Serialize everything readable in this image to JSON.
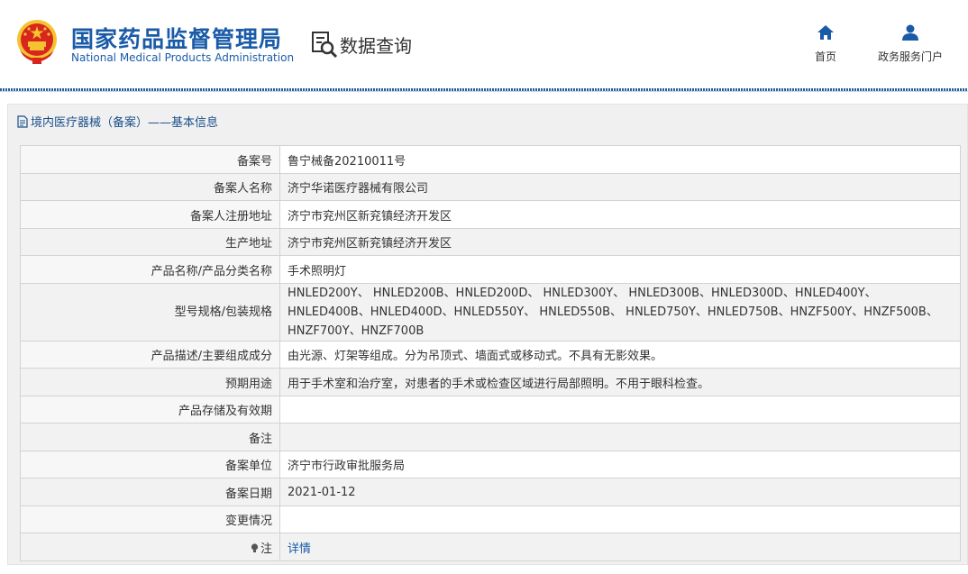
{
  "header": {
    "org_name_cn": "国家药品监督管理局",
    "org_name_en": "National Medical Products Administration",
    "query_label": "数据查询",
    "nav": [
      {
        "label": "首页",
        "icon": "home-icon"
      },
      {
        "label": "政务服务门户",
        "icon": "user-icon"
      }
    ]
  },
  "panel": {
    "title": "境内医疗器械（备案）——基本信息"
  },
  "rows": [
    {
      "label": "备案号",
      "value": "鲁宁械备20210011号"
    },
    {
      "label": "备案人名称",
      "value": "济宁华诺医疗器械有限公司"
    },
    {
      "label": "备案人注册地址",
      "value": "济宁市兖州区新兖镇经济开发区"
    },
    {
      "label": "生产地址",
      "value": "济宁市兖州区新兖镇经济开发区"
    },
    {
      "label": "产品名称/产品分类名称",
      "value": "手术照明灯"
    },
    {
      "label": "型号规格/包装规格",
      "value": "HNLED200Y、 HNLED200B、HNLED200D、 HNLED300Y、 HNLED300B、HNLED300D、HNLED400Y、HNLED400B、HNLED400D、HNLED550Y、 HNLED550B、 HNLED750Y、HNLED750B、HNZF500Y、HNZF500B、HNZF700Y、HNZF700B"
    },
    {
      "label": "产品描述/主要组成成分",
      "value": "由光源、灯架等组成。分为吊顶式、墙面式或移动式。不具有无影效果。"
    },
    {
      "label": "预期用途",
      "value": "用于手术室和治疗室，对患者的手术或检查区域进行局部照明。不用于眼科检查。"
    },
    {
      "label": "产品存储及有效期",
      "value": ""
    },
    {
      "label": "备注",
      "value": ""
    },
    {
      "label": "备案单位",
      "value": "济宁市行政审批服务局"
    },
    {
      "label": "备案日期",
      "value": "2021-01-12"
    },
    {
      "label": "变更情况",
      "value": ""
    },
    {
      "label": "注",
      "value": "详情"
    }
  ],
  "colors": {
    "brand_blue": "#1a5ba8",
    "emblem_red": "#d8261f",
    "emblem_gold": "#f4c430"
  }
}
